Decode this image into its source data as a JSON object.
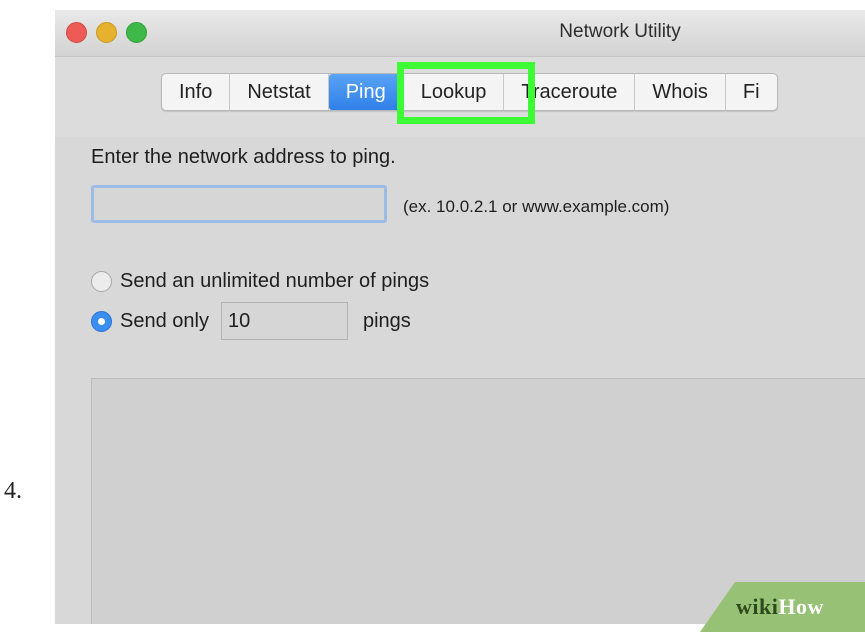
{
  "step_number": "4.",
  "window": {
    "title": "Network Utility"
  },
  "tabs": [
    {
      "label": "Info",
      "selected": false
    },
    {
      "label": "Netstat",
      "selected": false
    },
    {
      "label": "Ping",
      "selected": true
    },
    {
      "label": "Lookup",
      "selected": false
    },
    {
      "label": "Traceroute",
      "selected": false
    },
    {
      "label": "Whois",
      "selected": false
    },
    {
      "label": "Fi",
      "selected": false
    }
  ],
  "ping": {
    "prompt": "Enter the network address to ping.",
    "address_value": "",
    "example_hint": "(ex. 10.0.2.1 or www.example.com)",
    "option_unlimited": "Send an unlimited number of pings",
    "option_limited": "Send only",
    "count_value": "10",
    "count_unit": "pings",
    "selected_option": "limited"
  },
  "highlight_color": "#3dfb34",
  "accent_color": "#2f80e8",
  "watermark": {
    "part1": "wiki",
    "part2": "How"
  }
}
